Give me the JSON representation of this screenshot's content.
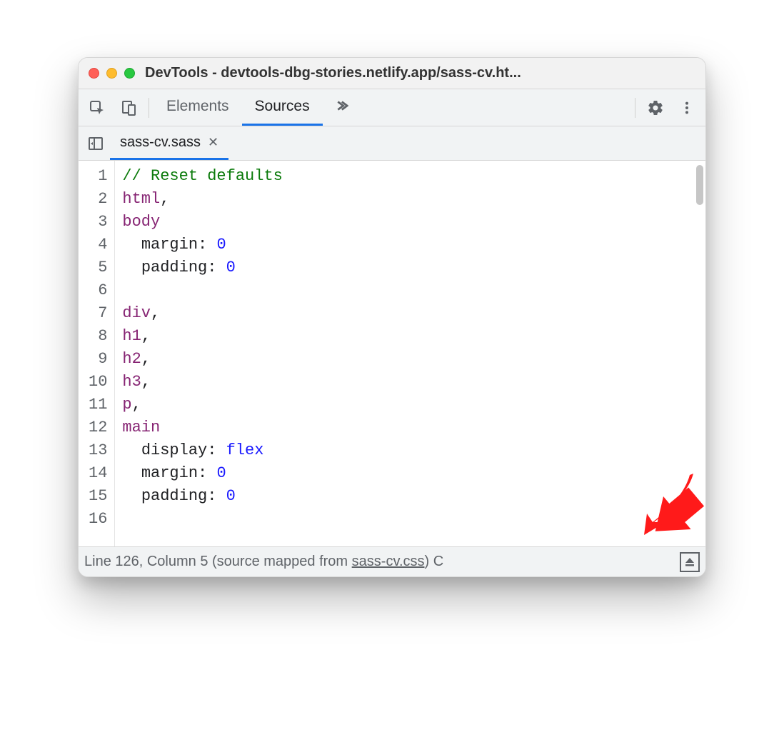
{
  "window": {
    "title": "DevTools - devtools-dbg-stories.netlify.app/sass-cv.ht..."
  },
  "toolbar": {
    "tabs": {
      "elements": "Elements",
      "sources": "Sources"
    }
  },
  "filetab": {
    "name": "sass-cv.sass"
  },
  "code": {
    "lines": [
      {
        "n": "1",
        "tokens": [
          {
            "t": "// Reset defaults",
            "c": "tok-comment"
          }
        ]
      },
      {
        "n": "2",
        "tokens": [
          {
            "t": "html",
            "c": "tok-sel"
          },
          {
            "t": ",",
            "c": ""
          }
        ]
      },
      {
        "n": "3",
        "tokens": [
          {
            "t": "body",
            "c": "tok-sel"
          }
        ]
      },
      {
        "n": "4",
        "tokens": [
          {
            "t": "  ",
            "c": ""
          },
          {
            "t": "margin",
            "c": "tok-prop"
          },
          {
            "t": ": ",
            "c": ""
          },
          {
            "t": "0",
            "c": "tok-val"
          }
        ]
      },
      {
        "n": "5",
        "tokens": [
          {
            "t": "  ",
            "c": ""
          },
          {
            "t": "padding",
            "c": "tok-prop"
          },
          {
            "t": ": ",
            "c": ""
          },
          {
            "t": "0",
            "c": "tok-val"
          }
        ]
      },
      {
        "n": "6",
        "tokens": []
      },
      {
        "n": "7",
        "tokens": [
          {
            "t": "div",
            "c": "tok-sel"
          },
          {
            "t": ",",
            "c": ""
          }
        ]
      },
      {
        "n": "8",
        "tokens": [
          {
            "t": "h1",
            "c": "tok-sel"
          },
          {
            "t": ",",
            "c": ""
          }
        ]
      },
      {
        "n": "9",
        "tokens": [
          {
            "t": "h2",
            "c": "tok-sel"
          },
          {
            "t": ",",
            "c": ""
          }
        ]
      },
      {
        "n": "10",
        "tokens": [
          {
            "t": "h3",
            "c": "tok-sel"
          },
          {
            "t": ",",
            "c": ""
          }
        ]
      },
      {
        "n": "11",
        "tokens": [
          {
            "t": "p",
            "c": "tok-sel"
          },
          {
            "t": ",",
            "c": ""
          }
        ]
      },
      {
        "n": "12",
        "tokens": [
          {
            "t": "main",
            "c": "tok-sel"
          }
        ]
      },
      {
        "n": "13",
        "tokens": [
          {
            "t": "  ",
            "c": ""
          },
          {
            "t": "display",
            "c": "tok-prop"
          },
          {
            "t": ": ",
            "c": ""
          },
          {
            "t": "flex",
            "c": "tok-val"
          }
        ]
      },
      {
        "n": "14",
        "tokens": [
          {
            "t": "  ",
            "c": ""
          },
          {
            "t": "margin",
            "c": "tok-prop"
          },
          {
            "t": ": ",
            "c": ""
          },
          {
            "t": "0",
            "c": "tok-val"
          }
        ]
      },
      {
        "n": "15",
        "tokens": [
          {
            "t": "  ",
            "c": ""
          },
          {
            "t": "padding",
            "c": "tok-prop"
          },
          {
            "t": ": ",
            "c": ""
          },
          {
            "t": "0",
            "c": "tok-val"
          }
        ]
      },
      {
        "n": "16",
        "tokens": []
      }
    ]
  },
  "status": {
    "line_col": "Line 126, Column 5",
    "mapped_prefix": "(source mapped from ",
    "mapped_file": "sass-cv.css",
    "mapped_suffix": ")",
    "trailing": " C"
  }
}
